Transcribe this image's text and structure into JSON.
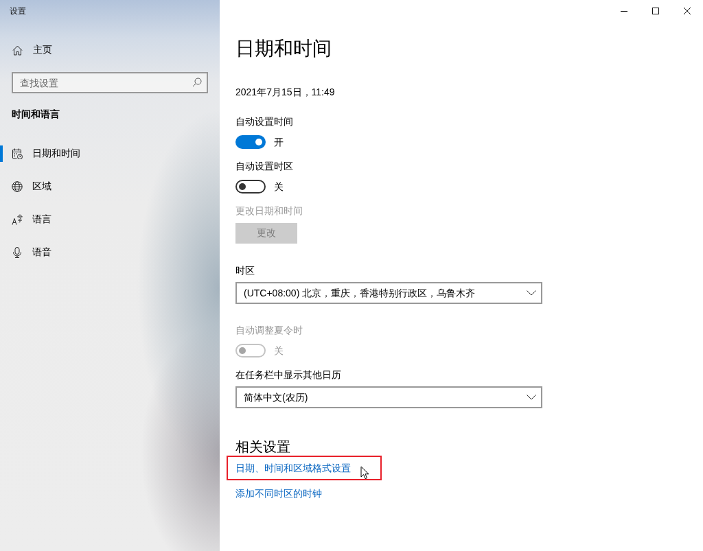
{
  "window": {
    "title": "设置"
  },
  "sidebar": {
    "home": {
      "label": "主页"
    },
    "search": {
      "placeholder": "查找设置"
    },
    "section_title": "时间和语言",
    "items": [
      {
        "label": "日期和时间",
        "selected": true
      },
      {
        "label": "区域",
        "selected": false
      },
      {
        "label": "语言",
        "selected": false
      },
      {
        "label": "语音",
        "selected": false
      }
    ]
  },
  "main": {
    "title": "日期和时间",
    "current_datetime": "2021年7月15日，11:49",
    "settings": [
      {
        "kind": "toggle",
        "label": "自动设置时间",
        "on": true,
        "state_text": "开",
        "disabled": false
      },
      {
        "kind": "toggle",
        "label": "自动设置时区",
        "on": false,
        "state_text": "关",
        "disabled": false
      },
      {
        "kind": "button",
        "label": "更改日期和时间",
        "button": "更改",
        "disabled": true
      },
      {
        "kind": "dropdown",
        "label": "时区",
        "value": "(UTC+08:00) 北京，重庆，香港特别行政区，乌鲁木齐",
        "disabled": false
      },
      {
        "kind": "toggle",
        "label": "自动调整夏令时",
        "on": false,
        "state_text": "关",
        "disabled": true
      },
      {
        "kind": "dropdown",
        "label": "在任务栏中显示其他日历",
        "value": "简体中文(农历)",
        "disabled": false
      }
    ],
    "related": {
      "title": "相关设置",
      "links": [
        {
          "label": "日期、时间和区域格式设置",
          "highlighted": true
        },
        {
          "label": "添加不同时区的时钟",
          "highlighted": false
        }
      ]
    }
  }
}
